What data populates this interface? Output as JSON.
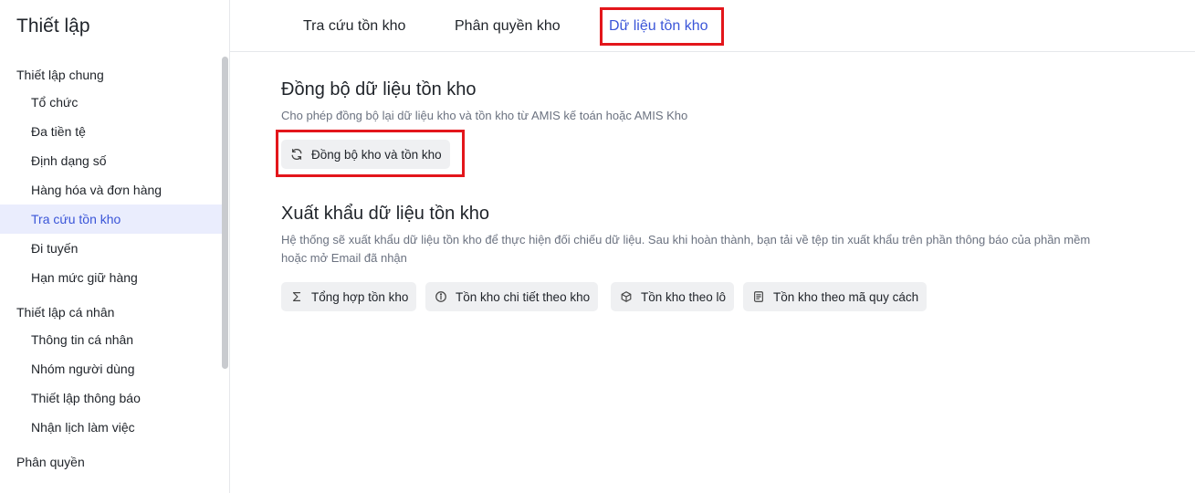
{
  "sidebar": {
    "title": "Thiết lập",
    "groups": [
      {
        "title": "Thiết lập chung",
        "items": [
          {
            "label": "Tổ chức"
          },
          {
            "label": "Đa tiền tệ"
          },
          {
            "label": "Định dạng số"
          },
          {
            "label": "Hàng hóa và đơn hàng"
          },
          {
            "label": "Tra cứu tồn kho",
            "active": true
          },
          {
            "label": "Đi tuyến"
          },
          {
            "label": "Hạn mức giữ hàng"
          }
        ]
      },
      {
        "title": "Thiết lập cá nhân",
        "items": [
          {
            "label": "Thông tin cá nhân"
          },
          {
            "label": "Nhóm người dùng"
          },
          {
            "label": "Thiết lập thông báo"
          },
          {
            "label": "Nhận lịch làm việc"
          }
        ]
      },
      {
        "title": "Phân quyền",
        "items": []
      }
    ]
  },
  "tabs": [
    {
      "label": "Tra cứu tồn kho"
    },
    {
      "label": "Phân quyền kho"
    },
    {
      "label": "Dữ liệu tồn kho",
      "active": true
    }
  ],
  "sync": {
    "title": "Đồng bộ dữ liệu tồn kho",
    "description": "Cho phép đồng bộ lại dữ liệu kho và tồn kho từ AMIS kế toán hoặc AMIS Kho",
    "button": {
      "label": "Đồng bộ kho và tồn kho",
      "icon": "refresh-icon"
    }
  },
  "export": {
    "title": "Xuất khẩu dữ liệu tồn kho",
    "description_line1": "Hệ thống sẽ xuất khẩu dữ liệu tồn kho để thực hiện đối chiếu dữ liệu. Sau khi hoàn thành, bạn tải về tệp tin xuất khẩu trên phần thông báo của phần mềm",
    "description_line2": "hoặc mở Email đã nhận",
    "buttons": [
      {
        "label": "Tổng hợp tồn kho",
        "icon": "sigma-icon"
      },
      {
        "label": "Tồn kho chi tiết theo kho",
        "icon": "info-icon"
      },
      {
        "label": "Tồn kho theo lô",
        "icon": "box-icon"
      },
      {
        "label": "Tồn kho theo mã quy cách",
        "icon": "document-icon"
      }
    ]
  },
  "colors": {
    "accent": "#3a55d8",
    "active_background": "#eaedfd",
    "highlight_red": "#e3161b"
  }
}
